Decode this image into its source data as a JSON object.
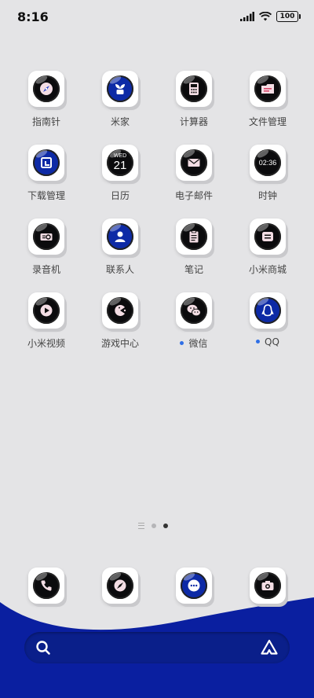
{
  "status_bar": {
    "time": "8:16",
    "battery": "100"
  },
  "colors": {
    "dock_blue": "#0a1fa0",
    "notification_dot": "#2f6fe6"
  },
  "apps": [
    {
      "label": "指南针",
      "icon": "compass-icon"
    },
    {
      "label": "米家",
      "icon": "mijia-plant-icon"
    },
    {
      "label": "计算器",
      "icon": "calculator-icon"
    },
    {
      "label": "文件管理",
      "icon": "folder-icon"
    },
    {
      "label": "下载管理",
      "icon": "download-icon"
    },
    {
      "label": "日历",
      "icon": "calendar-icon",
      "weekday": "WED",
      "day": "21"
    },
    {
      "label": "电子邮件",
      "icon": "mail-icon"
    },
    {
      "label": "时钟",
      "icon": "clock-icon",
      "time": "02:36"
    },
    {
      "label": "录音机",
      "icon": "recorder-icon"
    },
    {
      "label": "联系人",
      "icon": "contacts-icon"
    },
    {
      "label": "笔记",
      "icon": "notes-icon"
    },
    {
      "label": "小米商城",
      "icon": "mi-store-icon"
    },
    {
      "label": "小米视频",
      "icon": "video-play-icon"
    },
    {
      "label": "游戏中心",
      "icon": "game-center-icon"
    },
    {
      "label": "微信",
      "icon": "wechat-icon",
      "has_notification": true
    },
    {
      "label": "QQ",
      "icon": "qq-penguin-icon",
      "has_notification": true
    }
  ],
  "page_indicator": {
    "pages": 2,
    "current": 2
  },
  "dock": [
    {
      "icon": "phone-icon"
    },
    {
      "icon": "browser-icon"
    },
    {
      "icon": "messages-icon"
    },
    {
      "icon": "camera-icon"
    }
  ],
  "search_bar": {
    "left_icon": "search-icon",
    "right_icon": "assistant-icon"
  }
}
